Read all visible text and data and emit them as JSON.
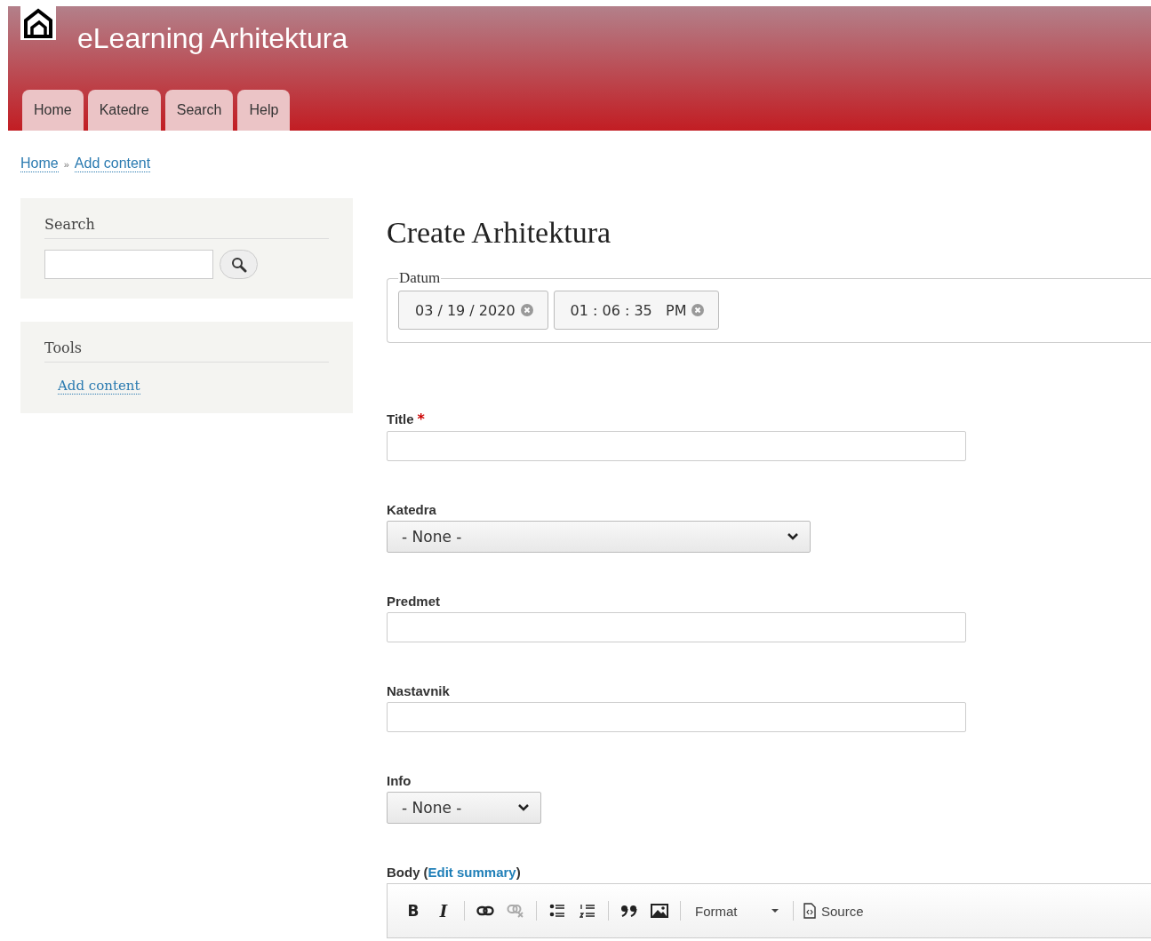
{
  "site": {
    "name": "eLearning Arhitektura"
  },
  "tabs": [
    {
      "label": "Home",
      "selected": false
    },
    {
      "label": "Katedre",
      "selected": false
    },
    {
      "label": "Search",
      "selected": false
    },
    {
      "label": "Help",
      "selected": false
    }
  ],
  "breadcrumb": [
    "Home",
    "Add content"
  ],
  "breadcrumb_separator": "»",
  "sidebar": [
    {
      "kind": "search",
      "title": "Search"
    },
    {
      "kind": "links",
      "title": "Tools",
      "links": [
        "Add content"
      ]
    }
  ],
  "page_title": "Create Arhitektura",
  "datum": {
    "legend": "Datum",
    "date": "03 / 19 / 2020",
    "time": "01 : 06 : 35   PM"
  },
  "fields": [
    {
      "kind": "text",
      "label": "Title",
      "required_mark": "*"
    },
    {
      "kind": "select",
      "label": "Katedra",
      "value": "- None -"
    },
    {
      "kind": "text",
      "label": "Predmet"
    },
    {
      "kind": "text",
      "label": "Nastavnik"
    },
    {
      "kind": "select",
      "label": "Info",
      "value": "- None -"
    }
  ],
  "body": {
    "label": "Body",
    "link": "Edit summary",
    "open_paren": "(",
    "close_paren": ")"
  },
  "toolbar": {
    "bold": "B",
    "italic": "I",
    "unlink_disabled": true,
    "format": "Format",
    "source": "Source"
  }
}
